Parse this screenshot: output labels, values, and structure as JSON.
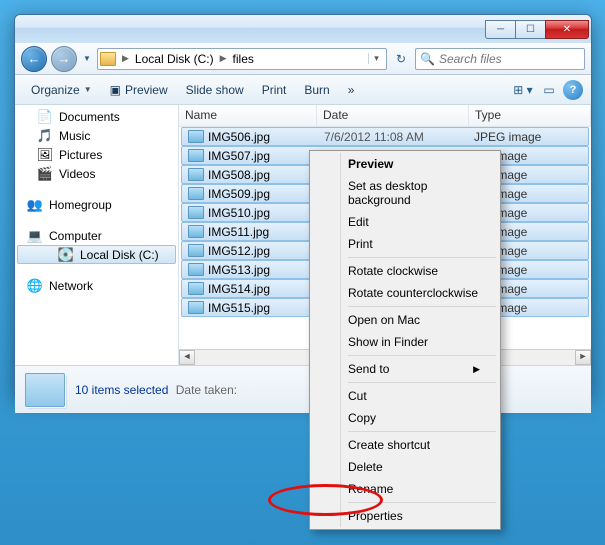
{
  "breadcrumb": {
    "root": "Local Disk (C:)",
    "current": "files"
  },
  "search": {
    "placeholder": "Search files"
  },
  "toolbar": {
    "organize": "Organize",
    "preview": "Preview",
    "slideshow": "Slide show",
    "print": "Print",
    "burn": "Burn",
    "overflow": "»"
  },
  "sidebar": {
    "documents": "Documents",
    "music": "Music",
    "pictures": "Pictures",
    "videos": "Videos",
    "homegroup": "Homegroup",
    "computer": "Computer",
    "localdisk": "Local Disk (C:)",
    "network": "Network"
  },
  "columns": {
    "name": "Name",
    "date": "Date",
    "type": "Type"
  },
  "files": [
    {
      "name": "IMG506.jpg",
      "date": "7/6/2012 11:08 AM",
      "type": "JPEG image"
    },
    {
      "name": "IMG507.jpg",
      "date": "",
      "type": "EG image"
    },
    {
      "name": "IMG508.jpg",
      "date": "",
      "type": "EG image"
    },
    {
      "name": "IMG509.jpg",
      "date": "",
      "type": "EG image"
    },
    {
      "name": "IMG510.jpg",
      "date": "",
      "type": "EG image"
    },
    {
      "name": "IMG511.jpg",
      "date": "",
      "type": "EG image"
    },
    {
      "name": "IMG512.jpg",
      "date": "",
      "type": "EG image"
    },
    {
      "name": "IMG513.jpg",
      "date": "",
      "type": "EG image"
    },
    {
      "name": "IMG514.jpg",
      "date": "",
      "type": "EG image"
    },
    {
      "name": "IMG515.jpg",
      "date": "",
      "type": "EG image"
    }
  ],
  "details": {
    "count": "10 items selected",
    "label": "Date taken:"
  },
  "ctx": {
    "preview": "Preview",
    "setbg": "Set as desktop background",
    "edit": "Edit",
    "print": "Print",
    "rotcw": "Rotate clockwise",
    "rotccw": "Rotate counterclockwise",
    "openmac": "Open on Mac",
    "finder": "Show in Finder",
    "sendto": "Send to",
    "cut": "Cut",
    "copy": "Copy",
    "shortcut": "Create shortcut",
    "delete": "Delete",
    "rename": "Rename",
    "properties": "Properties"
  }
}
